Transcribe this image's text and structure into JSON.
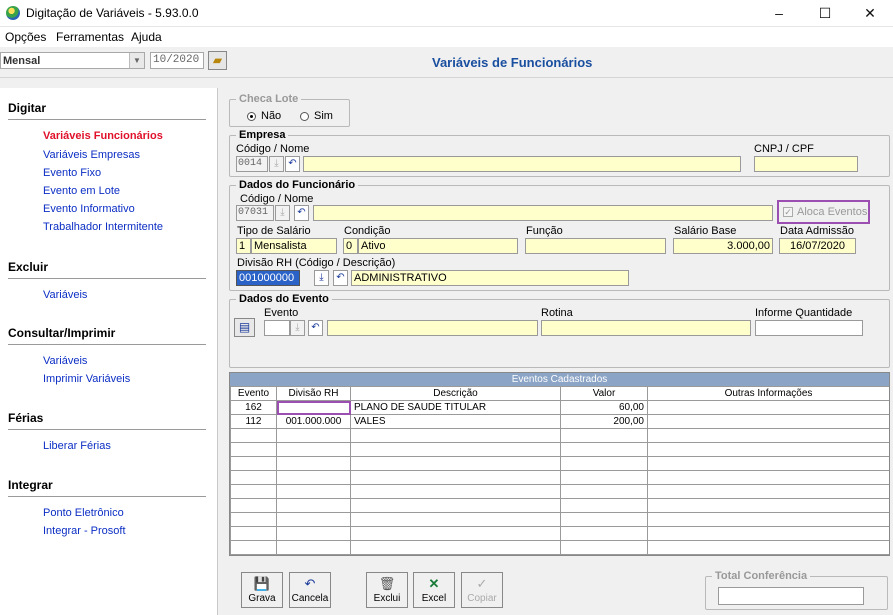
{
  "window": {
    "title": "Digitação de Variáveis - 5.93.0.0",
    "minimize": "–",
    "maximize": "☐",
    "close": "✕"
  },
  "menu": [
    "Opções",
    "Ferramentas",
    "Ajuda"
  ],
  "toolbar": {
    "period_type": "Mensal",
    "period": "10/2020",
    "page_title": "Variáveis de Funcionários"
  },
  "sidebar": {
    "sections": [
      {
        "title": "Digitar",
        "items": [
          "Variáveis Funcionários",
          "Variáveis Empresas",
          "Evento Fixo",
          "Evento em Lote",
          "Evento Informativo",
          "Trabalhador Intermitente"
        ]
      },
      {
        "title": "Excluir",
        "items": [
          "Variáveis"
        ]
      },
      {
        "title": "Consultar/Imprimir",
        "items": [
          "Variáveis",
          "Imprimir Variáveis"
        ]
      },
      {
        "title": "Férias",
        "items": [
          "Liberar Férias"
        ]
      },
      {
        "title": "Integrar",
        "items": [
          "Ponto Eletrônico",
          "Integrar - Prosoft"
        ]
      }
    ],
    "active_item": "Variáveis Funcionários"
  },
  "checa_lote": {
    "legend": "Checa Lote",
    "nao": "Não",
    "sim": "Sim",
    "selected": "Não"
  },
  "empresa": {
    "legend": "Empresa",
    "codigo_label": "Código / Nome",
    "codigo": "0014",
    "nome": "",
    "cnpj_label": "CNPJ / CPF",
    "cnpj": ""
  },
  "funcionario": {
    "legend": "Dados do Funcionário",
    "codigo_label": "Código / Nome",
    "codigo": "07031",
    "nome": "",
    "aloca_eventos": "Aloca Eventos",
    "tipo_salario_label": "Tipo de Salário",
    "tipo_salario_cod": "1",
    "tipo_salario": "Mensalista",
    "condicao_label": "Condição",
    "condicao_cod": "0",
    "condicao": "Ativo",
    "funcao_label": "Função",
    "funcao": "",
    "salario_base_label": "Salário Base",
    "salario_base": "3.000,00",
    "data_admissao_label": "Data Admissão",
    "data_admissao": "16/07/2020",
    "divisao_label": "Divisão RH (Código / Descrição)",
    "divisao_cod": "001000000",
    "divisao_desc": "ADMINISTRATIVO"
  },
  "evento": {
    "legend": "Dados do Evento",
    "evento_label": "Evento",
    "rotina_label": "Rotina",
    "informe_label": "Informe Quantidade"
  },
  "grid": {
    "caption": "Eventos Cadastrados",
    "headers": [
      "Evento",
      "Divisão RH",
      "Descrição",
      "Valor",
      "Outras Informações"
    ],
    "rows": [
      [
        "162",
        "",
        "PLANO DE SAUDE TITULAR",
        "60,00",
        ""
      ],
      [
        "112",
        "001.000.000",
        "VALES",
        "200,00",
        ""
      ]
    ]
  },
  "buttons": {
    "grava": "Grava",
    "cancela": "Cancela",
    "exclui": "Exclui",
    "excel": "Excel",
    "copiar": "Copiar"
  },
  "total": {
    "legend": "Total Conferência",
    "value": ""
  },
  "colors": {
    "accent": "#1a4fa0",
    "active_link": "#e0102a",
    "link": "#0b2ec4",
    "field_bg": "#ffffcc",
    "highlight": "#9b4fb0"
  }
}
